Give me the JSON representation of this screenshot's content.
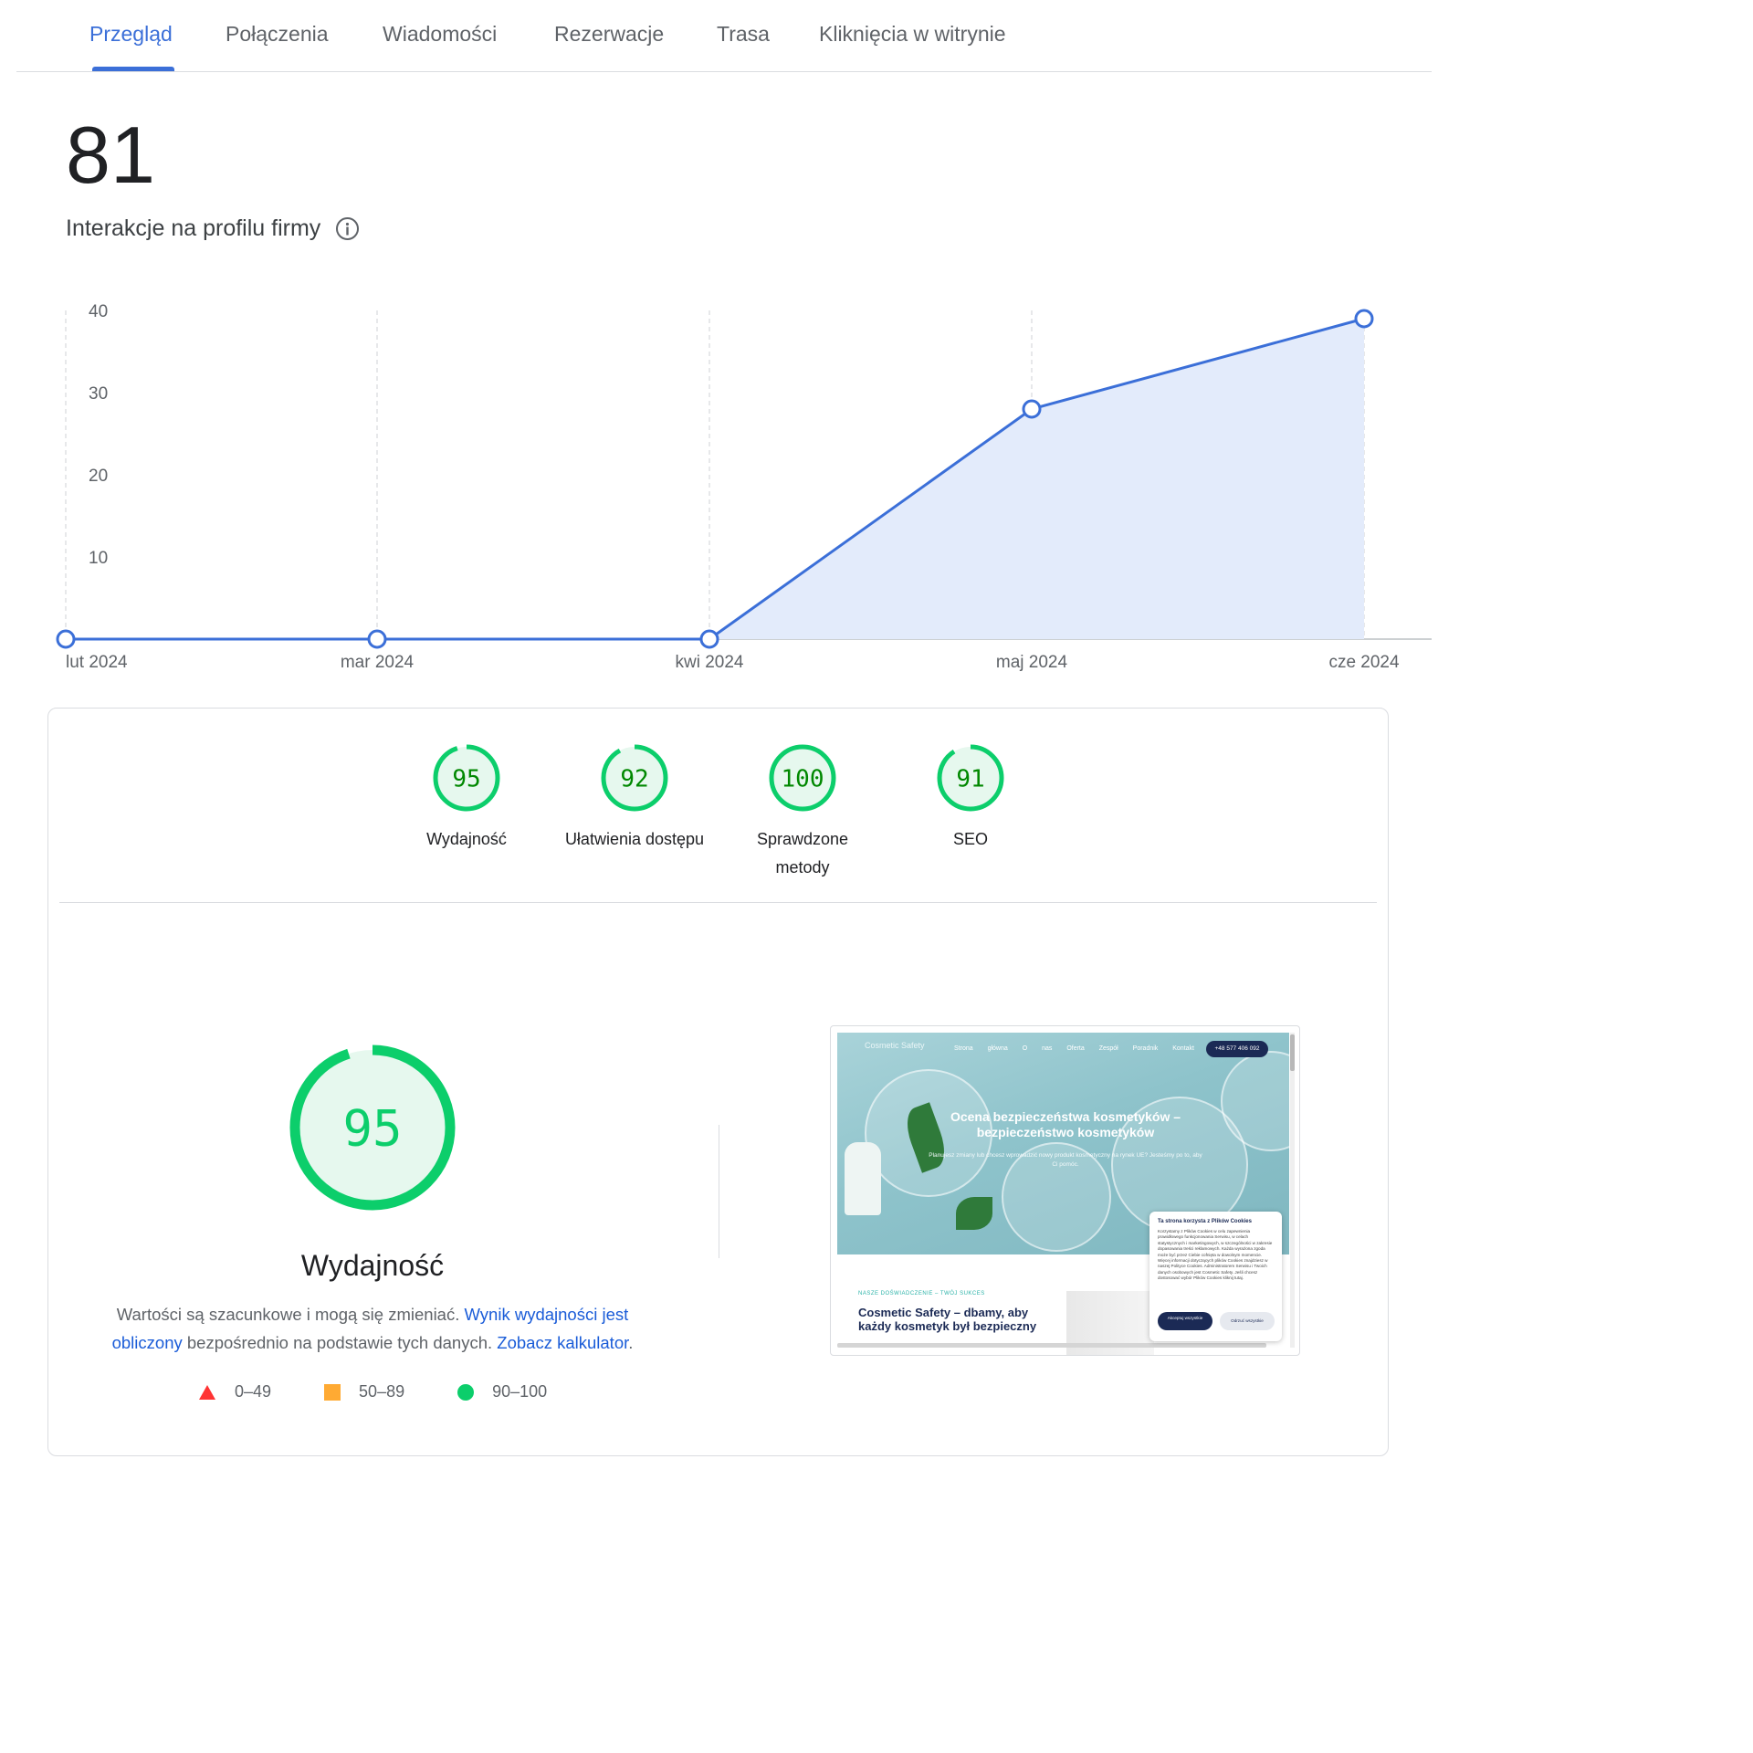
{
  "tabs": [
    {
      "label": "Przegląd",
      "active": true
    },
    {
      "label": "Połączenia",
      "active": false
    },
    {
      "label": "Wiadomości",
      "active": false
    },
    {
      "label": "Rezerwacje",
      "active": false
    },
    {
      "label": "Trasa",
      "active": false
    },
    {
      "label": "Kliknięcia w witrynie",
      "active": false
    }
  ],
  "kpi": {
    "value": "81",
    "label": "Interakcje na profilu firmy",
    "info_icon": "info-icon"
  },
  "chart_data": {
    "type": "area",
    "x": [
      "lut 2024",
      "mar 2024",
      "kwi 2024",
      "maj 2024",
      "cze 2024"
    ],
    "values": [
      0,
      0,
      0,
      28,
      39
    ],
    "yticks": [
      10,
      20,
      30,
      40
    ],
    "ylim": [
      0,
      40
    ],
    "title": "",
    "xlabel": "",
    "ylabel": "",
    "grid": "vertical-dashed",
    "colors": {
      "line": "#3b6fd8",
      "fill": "#e3ebfb",
      "marker_fill": "#ffffff"
    }
  },
  "scores": [
    {
      "value": "95",
      "label": "Wydajność"
    },
    {
      "value": "92",
      "label": "Ułatwienia dostępu"
    },
    {
      "value": "100",
      "label": "Sprawdzone metody"
    },
    {
      "value": "91",
      "label": "SEO"
    }
  ],
  "performance": {
    "score": "95",
    "title": "Wydajność",
    "desc_text1": "Wartości są szacunkowe i mogą się zmieniać. ",
    "desc_link1": "Wynik wydajności jest obliczony",
    "desc_text2": " bezpośrednio na podstawie tych danych. ",
    "desc_link2": "Zobacz kalkulator",
    "desc_text3": "."
  },
  "legend": [
    {
      "range": "0–49",
      "shape": "triangle",
      "color": "#ff3333"
    },
    {
      "range": "50–89",
      "shape": "square",
      "color": "#ffaa33"
    },
    {
      "range": "90–100",
      "shape": "circle",
      "color": "#0cce6b"
    }
  ],
  "colors": {
    "tab_active": "#3b6fd8",
    "score_good": "#0cce6b",
    "score_good_text": "#008800",
    "score_good_bg": "#e6f8ee",
    "link": "#1a5cd8"
  },
  "preview": {
    "logo": "Cosmetic Safety",
    "nav": "Strona główna O nas Oferta Zespół Poradnik Kontakt",
    "phone": "+48 577 406 092",
    "hero_title": "Ocena bezpieczeństwa kosmetyków – bezpieczeństwo kosmetyków",
    "hero_sub": "Planujesz zmiany lub chcesz wprowadzić nowy produkt kosmetyczny na rynek UE? Jesteśmy po to, aby Ci pomóc.",
    "kicker": "NASZE DOŚWIADCZENIE – TWÓJ SUKCES",
    "section_title": "Cosmetic Safety – dbamy, aby każdy kosmetyk był bezpieczny",
    "cookie": {
      "title": "Ta strona korzysta z Plików Cookies",
      "text": "Korzystamy z Plików Cookies w celu zapewnienia prawidłowego funkcjonowania Serwisu, w celach statystycznych i marketingowych, w szczególności w zakresie dopasowania treści reklamowych. Każda wyrażona zgoda może być przez Ciebie cofnięta w dowolnym momencie. Więcej informacji dotyczących plików Cookies znajdziesz w naszej Polityce Cookies. Administratorem Serwisu i Twoich danych osobowych jest Cosmetic Safety. Jeśli chcesz dostosować wybór Plików Cookies kliknij tutaj.",
      "accept": "Akceptuj wszystkie",
      "reject": "Odrzuć wszystkie"
    }
  }
}
